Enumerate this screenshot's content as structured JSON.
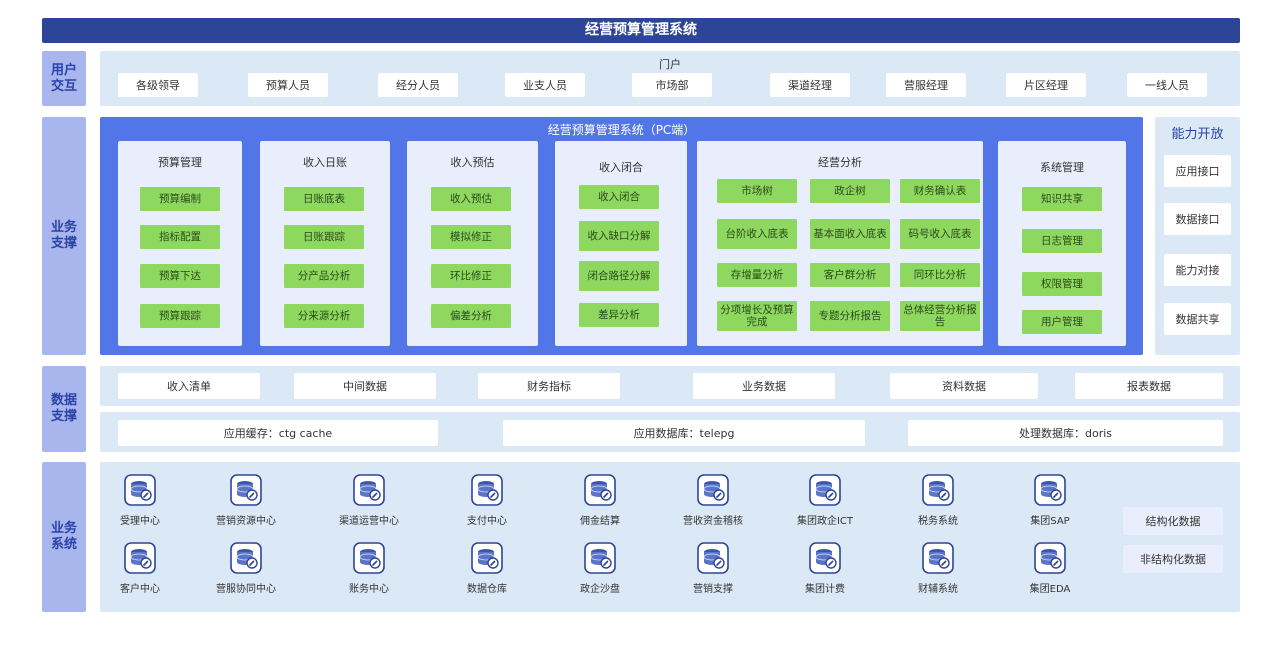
{
  "title": "经营预算管理系统",
  "layers": {
    "user": "用户交互",
    "business": "业务支撑",
    "data": "数据支撑",
    "systems": "业务系统"
  },
  "portal": {
    "label": "门户",
    "users": [
      "各级领导",
      "预算人员",
      "经分人员",
      "业支人员",
      "市场部",
      "渠道经理",
      "营服经理",
      "片区经理",
      "一线人员"
    ]
  },
  "pc": {
    "title": "经营预算管理系统（PC端）",
    "modules": [
      {
        "title": "预算管理",
        "items": [
          "预算编制",
          "指标配置",
          "预算下达",
          "预算跟踪"
        ]
      },
      {
        "title": "收入日账",
        "items": [
          "日账底表",
          "日账跟踪",
          "分产品分析",
          "分来源分析"
        ]
      },
      {
        "title": "收入预估",
        "items": [
          "收入预估",
          "模拟修正",
          "环比修正",
          "偏差分析"
        ]
      },
      {
        "title": "收入闭合",
        "items": [
          "收入闭合",
          "收入缺口分解",
          "闭合路径分解",
          "差异分析"
        ]
      },
      {
        "title": "经营分析",
        "items": [
          "市场树",
          "政企树",
          "财务确认表",
          "台阶收入底表",
          "基本面收入底表",
          "码号收入底表",
          "存增量分析",
          "客户群分析",
          "同环比分析",
          "分项增长及预算完成",
          "专题分析报告",
          "总体经营分析报告"
        ]
      },
      {
        "title": "系统管理",
        "items": [
          "知识共享",
          "日志管理",
          "权限管理",
          "用户管理"
        ]
      }
    ]
  },
  "open": {
    "title": "能力开放",
    "items": [
      "应用接口",
      "数据接口",
      "能力对接",
      "数据共享"
    ]
  },
  "data_support": {
    "row1": [
      "收入清单",
      "中间数据",
      "财务指标",
      "业务数据",
      "资料数据",
      "报表数据"
    ],
    "row2": [
      "应用缓存：ctg cache",
      "应用数据库：telepg",
      "处理数据库：doris"
    ]
  },
  "systems": {
    "row1": [
      "受理中心",
      "营销资源中心",
      "渠道运营中心",
      "支付中心",
      "佣金结算",
      "营收资金稽核",
      "集团政企ICT",
      "税务系统",
      "集团SAP"
    ],
    "row2": [
      "客户中心",
      "营服协同中心",
      "账务中心",
      "数据仓库",
      "政企沙盘",
      "营销支撑",
      "集团计费",
      "财辅系统",
      "集团EDA"
    ],
    "side": [
      "结构化数据",
      "非结构化数据"
    ],
    "icon": "database-wrench-icon"
  },
  "colors": {
    "title_bar": "#2d4597",
    "layer_label": "#a9b6ee",
    "band": "#dbe9f6",
    "pc_panel": "#5276e7",
    "module": "#e8eefb",
    "green_item": "#8fd860"
  }
}
